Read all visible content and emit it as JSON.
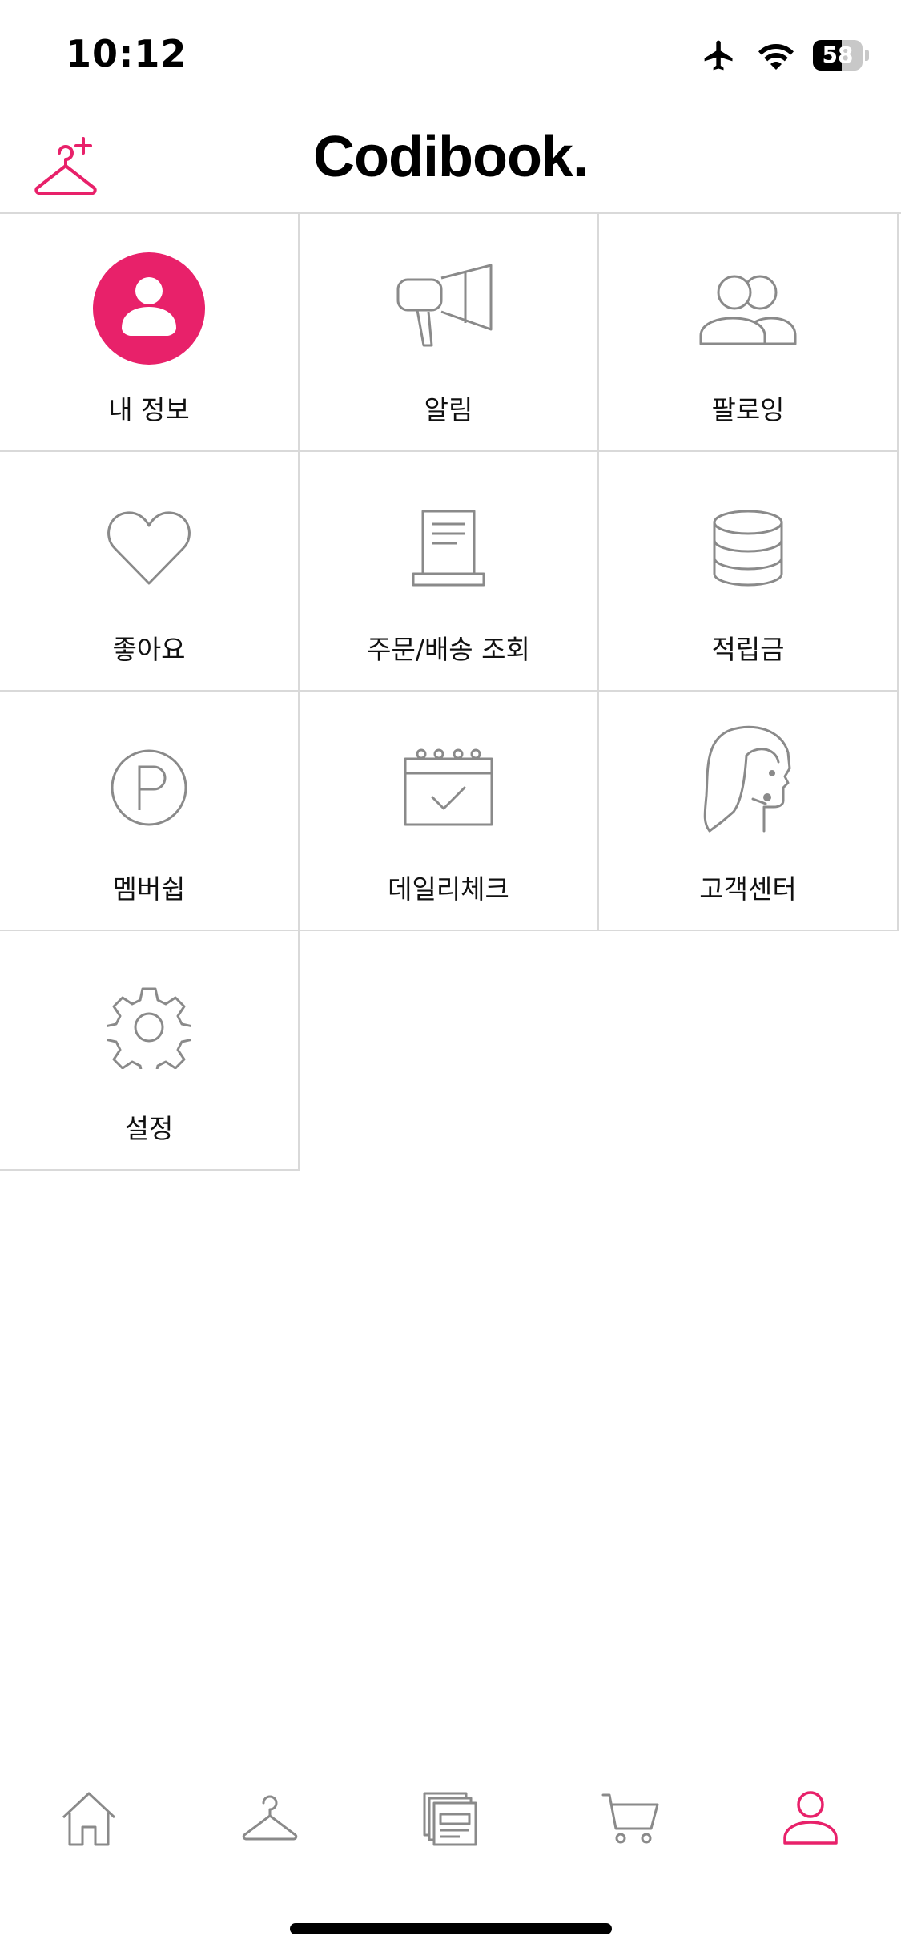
{
  "status_bar": {
    "time": "10:12",
    "battery_level": "58",
    "battery_fraction": 0.58
  },
  "header": {
    "logo": "Codibook."
  },
  "menu": [
    {
      "label": "내 정보",
      "icon": "profile-icon"
    },
    {
      "label": "알림",
      "icon": "megaphone-icon"
    },
    {
      "label": "팔로잉",
      "icon": "following-users-icon"
    },
    {
      "label": "좋아요",
      "icon": "heart-icon"
    },
    {
      "label": "주문/배송 조회",
      "icon": "order-receipt-icon"
    },
    {
      "label": "적립금",
      "icon": "coins-stack-icon"
    },
    {
      "label": "멤버쉽",
      "icon": "membership-p-icon"
    },
    {
      "label": "데일리체크",
      "icon": "calendar-check-icon"
    },
    {
      "label": "고객센터",
      "icon": "customer-service-icon"
    },
    {
      "label": "설정",
      "icon": "gear-icon"
    }
  ],
  "tabs": [
    {
      "name": "home",
      "icon": "home-icon"
    },
    {
      "name": "closet",
      "icon": "hanger-icon"
    },
    {
      "name": "feed",
      "icon": "feed-cards-icon"
    },
    {
      "name": "cart",
      "icon": "cart-icon"
    },
    {
      "name": "my-page",
      "icon": "user-icon",
      "active": true
    }
  ],
  "colors": {
    "accent": "#e8216a",
    "icon_gray": "#8a8a8a",
    "divider": "#d9d9d9"
  }
}
